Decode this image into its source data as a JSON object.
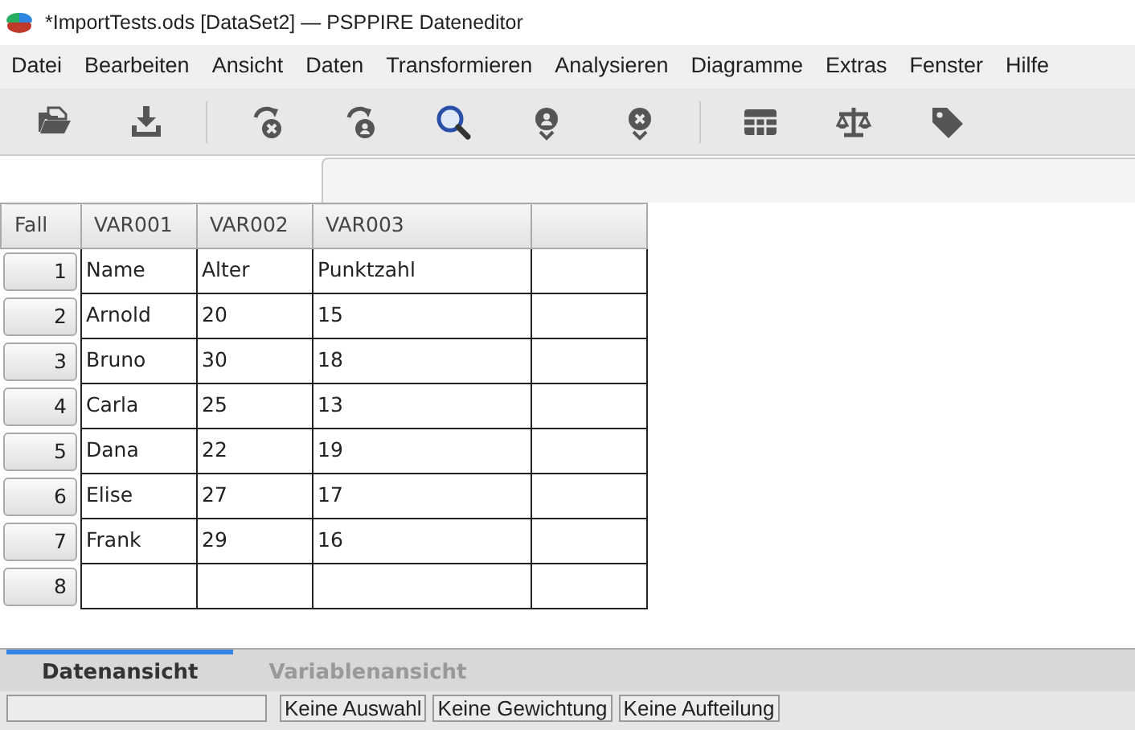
{
  "window": {
    "title": "*ImportTests.ods [DataSet2] — PSPPIRE Dateneditor"
  },
  "menu": [
    "Datei",
    "Bearbeiten",
    "Ansicht",
    "Daten",
    "Transformieren",
    "Analysieren",
    "Diagramme",
    "Extras",
    "Fenster",
    "Hilfe"
  ],
  "grid": {
    "columns": [
      "Fall",
      "VAR001",
      "VAR002",
      "VAR003"
    ],
    "rows": [
      [
        "1",
        "Name",
        "Alter",
        "Punktzahl"
      ],
      [
        "2",
        "Arnold",
        "20",
        "15"
      ],
      [
        "3",
        "Bruno",
        "30",
        "18"
      ],
      [
        "4",
        "Carla",
        "25",
        "13"
      ],
      [
        "5",
        "Dana",
        "22",
        "19"
      ],
      [
        "6",
        "Elise",
        "27",
        "17"
      ],
      [
        "7",
        "Frank",
        "29",
        "16"
      ],
      [
        "8"
      ]
    ]
  },
  "tabs": [
    {
      "label": "Datenansicht",
      "selected": true
    },
    {
      "label": "Variablenansicht",
      "selected": false
    }
  ],
  "status_bar": [
    "Keine Auswahl",
    "Keine Gewichtung",
    "Keine Aufteilung"
  ]
}
